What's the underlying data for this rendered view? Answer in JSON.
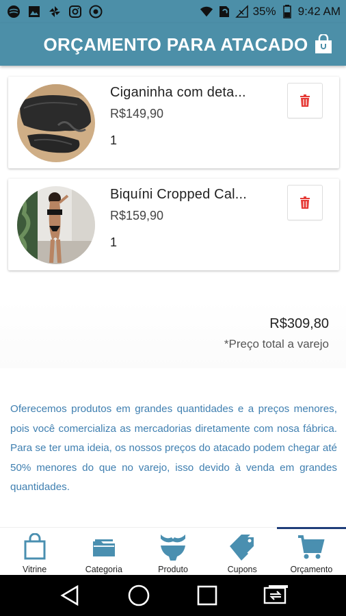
{
  "status_bar": {
    "battery": "35%",
    "time": "9:42 AM"
  },
  "header": {
    "title": "ORÇAMENTO PARA ATACADO"
  },
  "cart": {
    "items": [
      {
        "name": "Ciganinha com deta...",
        "price": "R$149,90",
        "quantity": "1"
      },
      {
        "name": "Biquíni Cropped Cal...",
        "price": "R$159,90",
        "quantity": "1"
      }
    ]
  },
  "total": {
    "value": "R$309,80",
    "note": "*Preço total a varejo"
  },
  "info_text": "Oferecemos produtos em grandes quantidades e a preços menores, pois você comercializa as mercadorias diretamente com nosa fábrica. Para se ter uma ideia, os nossos preços do atacado podem chegar até 50% menores do que no varejo, isso devido à venda em grandes quantidades.",
  "bottom_nav": {
    "items": [
      {
        "label": "Vitrine",
        "icon": "shopping-bag-icon"
      },
      {
        "label": "Categoria",
        "icon": "folder-icon"
      },
      {
        "label": "Produto",
        "icon": "bikini-icon"
      },
      {
        "label": "Cupons",
        "icon": "tag-icon"
      },
      {
        "label": "Orçamento",
        "icon": "cart-icon"
      }
    ],
    "active": "Orçamento"
  },
  "colors": {
    "primary": "#4c8fa8",
    "nav_icon": "#4a8fb0",
    "delete": "#e53935",
    "info_text": "#3f7fb0",
    "active_indicator": "#1f3d7a"
  }
}
